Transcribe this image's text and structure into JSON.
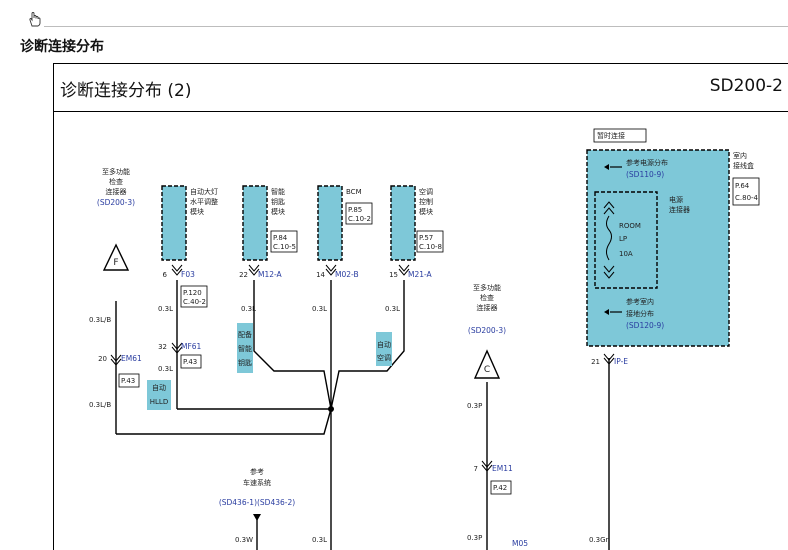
{
  "page": {
    "title": "诊断连接分布"
  },
  "diagram": {
    "title": "诊断连接分布 (2)",
    "code": "SD200-2"
  },
  "colors": {
    "module_fill": "#7ec8d8",
    "link_blue": "#2a3da0",
    "wire": "#000000"
  },
  "modules": [
    {
      "l1": "自动大灯",
      "l2": "水平调整",
      "l3": "模块"
    },
    {
      "l1": "智能",
      "l2": "钥匙",
      "l3": "模块"
    },
    {
      "l1": "BCM"
    },
    {
      "l1": "空调",
      "l2": "控制",
      "l3": "模块"
    }
  ],
  "module_refs": [
    {
      "p": "P.84",
      "c": "C.10-5"
    },
    {
      "p": "P.85",
      "c": "C.10-2"
    },
    {
      "p": "P.57",
      "c": "C.10-8"
    }
  ],
  "connectors": [
    {
      "pin": "6",
      "id": "F03"
    },
    {
      "pin": "22",
      "id": "M12-A"
    },
    {
      "pin": "14",
      "id": "M02-B"
    },
    {
      "pin": "15",
      "id": "M21-A"
    },
    {
      "pin": "32",
      "id": "MF61"
    },
    {
      "pin": "20",
      "id": "EM61"
    },
    {
      "pin": "7",
      "id": "EM11"
    },
    {
      "pin": "21",
      "id": "IP-E"
    }
  ],
  "refs": {
    "f03": {
      "p": "P.120",
      "c": "C.40-2"
    },
    "mf61": "P.43",
    "em61": "P.43",
    "em11": "P.42"
  },
  "wires": {
    "w1": "0.3L/B",
    "w2": "0.3L/B",
    "w3": "0.3L",
    "w4": "0.3L",
    "w5": "0.3L",
    "w6": "0.3L",
    "w7": "0.3L",
    "w8": "0.3P",
    "w9": "0.3P",
    "w10": "0.3W",
    "w11": "0.3L",
    "w12": "0.3Gr"
  },
  "left_link": {
    "l1": "至多功能",
    "l2": "检查",
    "l3": "连接器",
    "ref": "(SD200-3)",
    "letter": "F"
  },
  "mid_link": {
    "l1": "至多功能",
    "l2": "检查",
    "l3": "连接器",
    "ref": "(SD200-3)",
    "letter": "C"
  },
  "tags": {
    "hlld1": "自动",
    "hlld2": "HLLD",
    "smart1": "配备",
    "smart2": "智能",
    "smart3": "钥匙",
    "auto1": "自动",
    "auto2": "空调"
  },
  "bottom_ref": {
    "l1": "参考",
    "l2": "车速系统",
    "ref": "(SD436-1)(SD436-2)"
  },
  "bottom_connector": "M05",
  "junction": {
    "header": "暂时连接",
    "room1": "室内",
    "room2": "接线盒",
    "ref_p": "P.64",
    "ref_c": "C.80-4",
    "power_ref1": "参考电源分布",
    "power_ref1_code": "(SD110-9)",
    "fuse_l1": "电源",
    "fuse_l2": "连接器",
    "fuse_name1": "ROOM",
    "fuse_name2": "LP",
    "fuse_amp": "10A",
    "gnd_ref1": "参考室内",
    "gnd_ref2": "接地分布",
    "gnd_ref_code": "(SD120-9)"
  }
}
